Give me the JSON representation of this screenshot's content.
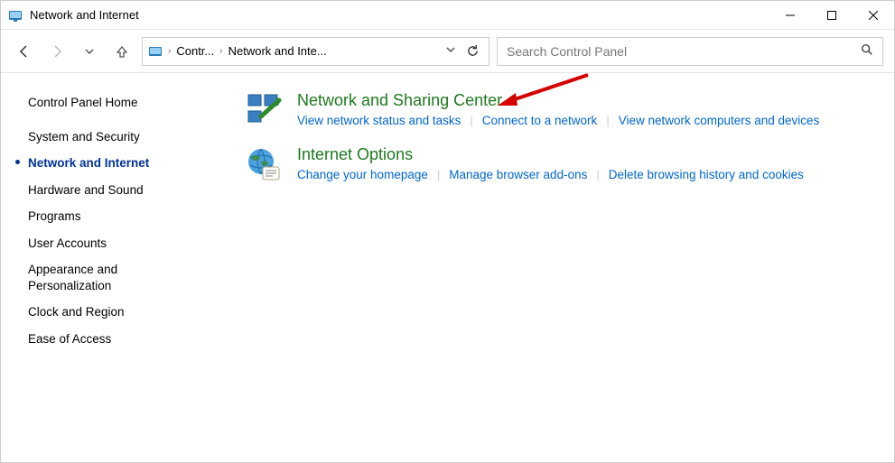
{
  "window": {
    "title": "Network and Internet"
  },
  "breadcrumb": {
    "seg1": "Contr...",
    "seg2": "Network and Inte..."
  },
  "search": {
    "placeholder": "Search Control Panel"
  },
  "sidebar": {
    "home": "Control Panel Home",
    "items": [
      "System and Security",
      "Network and Internet",
      "Hardware and Sound",
      "Programs",
      "User Accounts",
      "Appearance and Personalization",
      "Clock and Region",
      "Ease of Access"
    ],
    "active_index": 1
  },
  "categories": [
    {
      "title": "Network and Sharing Center",
      "links": [
        "View network status and tasks",
        "Connect to a network",
        "View network computers and devices"
      ]
    },
    {
      "title": "Internet Options",
      "links": [
        "Change your homepage",
        "Manage browser add-ons",
        "Delete browsing history and cookies"
      ]
    }
  ]
}
